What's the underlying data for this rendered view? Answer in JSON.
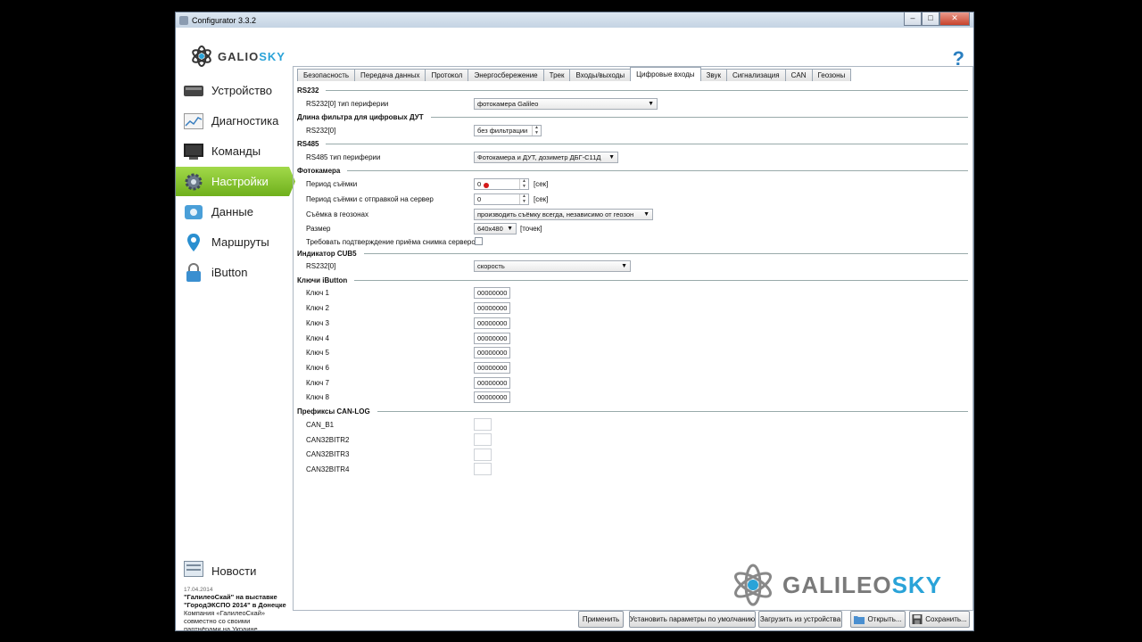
{
  "window": {
    "title": "Configurator 3.3.2"
  },
  "header": {
    "logo_left": "GALI",
    "logo_right": "SKY",
    "help": "?"
  },
  "sidebar": {
    "items": [
      {
        "label": "Устройство",
        "icon": "device-icon"
      },
      {
        "label": "Диагностика",
        "icon": "chart-icon"
      },
      {
        "label": "Команды",
        "icon": "terminal-icon"
      },
      {
        "label": "Настройки",
        "icon": "gear-icon"
      },
      {
        "label": "Данные",
        "icon": "data-icon"
      },
      {
        "label": "Маршруты",
        "icon": "map-pin-icon"
      },
      {
        "label": "iButton",
        "icon": "lock-icon"
      }
    ],
    "news": {
      "label": "Новости",
      "date": "17.04.2014",
      "headline": "\"ГалилеоСкай\" на выставке \"ГородЭКСПО 2014\" в Донецке",
      "body": "Компания «ГалилеоСкай» совместно со своими партнёрами на Украине"
    }
  },
  "tabs": [
    "Безопасность",
    "Передача данных",
    "Протокол",
    "Энергосбережение",
    "Трек",
    "Входы/выходы",
    "Цифровые входы",
    "Звук",
    "Сигнализация",
    "CAN",
    "Геозоны"
  ],
  "active_tab": "Цифровые входы",
  "sections": {
    "rs232": {
      "title": "RS232",
      "label": "RS232[0] тип периферии",
      "value": "фотокамера Galileo"
    },
    "filter": {
      "title": "Длина фильтра для цифровых ДУТ",
      "label": "RS232[0]",
      "value": "без фильтрации"
    },
    "rs485": {
      "title": "RS485",
      "label": "RS485 тип периферии",
      "value": "Фотокамера и ДУТ, дозиметр ДБГ-С11Д"
    },
    "camera": {
      "title": "Фотокамера",
      "period_label": "Период съёмки",
      "period_value": "0",
      "period_unit": "[сек]",
      "period_send_label": "Период съёмки с отправкой на сервер",
      "period_send_value": "0",
      "period_send_unit": "[сек]",
      "geozone_label": "Съёмка в геозонах",
      "geozone_value": "производить съёмку всегда, независимо от геозон",
      "size_label": "Размер",
      "size_value": "640x480",
      "size_unit": "[точек]",
      "confirm_label": "Требовать подтверждение приёма снимка сервером"
    },
    "cub5": {
      "title": "Индикатор CUB5",
      "label": "RS232[0]",
      "value": "скорость"
    },
    "ibutton": {
      "title": "Ключи iButton",
      "keys": [
        {
          "label": "Ключ 1",
          "value": "00000000"
        },
        {
          "label": "Ключ 2",
          "value": "00000000"
        },
        {
          "label": "Ключ 3",
          "value": "00000000"
        },
        {
          "label": "Ключ 4",
          "value": "00000000"
        },
        {
          "label": "Ключ 5",
          "value": "00000000"
        },
        {
          "label": "Ключ 6",
          "value": "00000000"
        },
        {
          "label": "Ключ 7",
          "value": "00000000"
        },
        {
          "label": "Ключ 8",
          "value": "00000000"
        }
      ]
    },
    "canlog": {
      "title": "Префиксы CAN-LOG",
      "items": [
        "CAN_B1",
        "CAN32BITR2",
        "CAN32BITR3",
        "CAN32BITR4"
      ]
    }
  },
  "brand": {
    "left": "GALILEO",
    "right": "SKY"
  },
  "buttons": {
    "apply": "Применить",
    "defaults": "Установить параметры по умолчанию",
    "load": "Загрузить из устройства",
    "open": "Открыть...",
    "save": "Сохранить..."
  },
  "colors": {
    "accent_green": "#7fbf2a",
    "brand_blue": "#2aa3d8"
  }
}
